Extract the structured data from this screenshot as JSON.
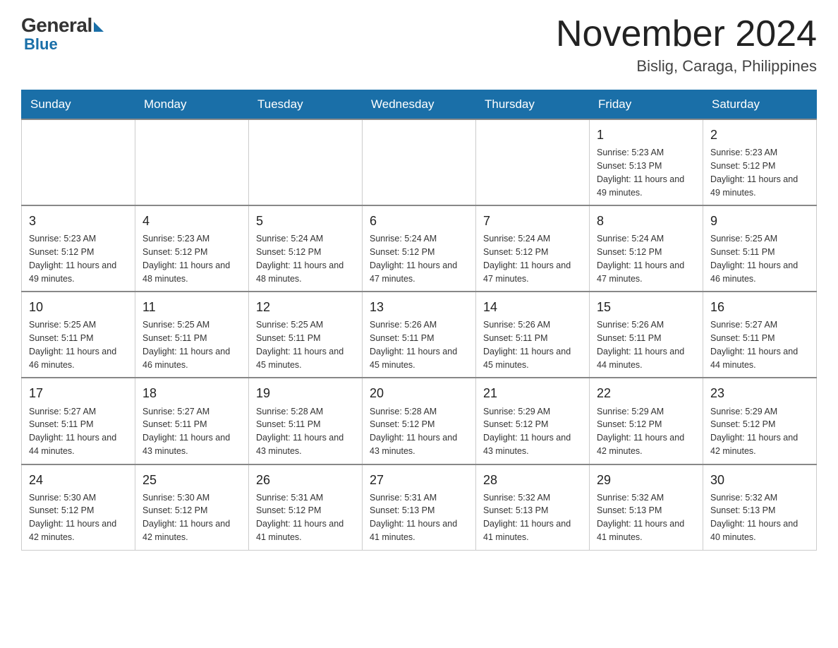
{
  "logo": {
    "general": "General",
    "blue": "Blue"
  },
  "title": {
    "month": "November 2024",
    "location": "Bislig, Caraga, Philippines"
  },
  "days_of_week": [
    "Sunday",
    "Monday",
    "Tuesday",
    "Wednesday",
    "Thursday",
    "Friday",
    "Saturday"
  ],
  "weeks": [
    [
      {
        "day": "",
        "info": ""
      },
      {
        "day": "",
        "info": ""
      },
      {
        "day": "",
        "info": ""
      },
      {
        "day": "",
        "info": ""
      },
      {
        "day": "",
        "info": ""
      },
      {
        "day": "1",
        "info": "Sunrise: 5:23 AM\nSunset: 5:13 PM\nDaylight: 11 hours and 49 minutes."
      },
      {
        "day": "2",
        "info": "Sunrise: 5:23 AM\nSunset: 5:12 PM\nDaylight: 11 hours and 49 minutes."
      }
    ],
    [
      {
        "day": "3",
        "info": "Sunrise: 5:23 AM\nSunset: 5:12 PM\nDaylight: 11 hours and 49 minutes."
      },
      {
        "day": "4",
        "info": "Sunrise: 5:23 AM\nSunset: 5:12 PM\nDaylight: 11 hours and 48 minutes."
      },
      {
        "day": "5",
        "info": "Sunrise: 5:24 AM\nSunset: 5:12 PM\nDaylight: 11 hours and 48 minutes."
      },
      {
        "day": "6",
        "info": "Sunrise: 5:24 AM\nSunset: 5:12 PM\nDaylight: 11 hours and 47 minutes."
      },
      {
        "day": "7",
        "info": "Sunrise: 5:24 AM\nSunset: 5:12 PM\nDaylight: 11 hours and 47 minutes."
      },
      {
        "day": "8",
        "info": "Sunrise: 5:24 AM\nSunset: 5:12 PM\nDaylight: 11 hours and 47 minutes."
      },
      {
        "day": "9",
        "info": "Sunrise: 5:25 AM\nSunset: 5:11 PM\nDaylight: 11 hours and 46 minutes."
      }
    ],
    [
      {
        "day": "10",
        "info": "Sunrise: 5:25 AM\nSunset: 5:11 PM\nDaylight: 11 hours and 46 minutes."
      },
      {
        "day": "11",
        "info": "Sunrise: 5:25 AM\nSunset: 5:11 PM\nDaylight: 11 hours and 46 minutes."
      },
      {
        "day": "12",
        "info": "Sunrise: 5:25 AM\nSunset: 5:11 PM\nDaylight: 11 hours and 45 minutes."
      },
      {
        "day": "13",
        "info": "Sunrise: 5:26 AM\nSunset: 5:11 PM\nDaylight: 11 hours and 45 minutes."
      },
      {
        "day": "14",
        "info": "Sunrise: 5:26 AM\nSunset: 5:11 PM\nDaylight: 11 hours and 45 minutes."
      },
      {
        "day": "15",
        "info": "Sunrise: 5:26 AM\nSunset: 5:11 PM\nDaylight: 11 hours and 44 minutes."
      },
      {
        "day": "16",
        "info": "Sunrise: 5:27 AM\nSunset: 5:11 PM\nDaylight: 11 hours and 44 minutes."
      }
    ],
    [
      {
        "day": "17",
        "info": "Sunrise: 5:27 AM\nSunset: 5:11 PM\nDaylight: 11 hours and 44 minutes."
      },
      {
        "day": "18",
        "info": "Sunrise: 5:27 AM\nSunset: 5:11 PM\nDaylight: 11 hours and 43 minutes."
      },
      {
        "day": "19",
        "info": "Sunrise: 5:28 AM\nSunset: 5:11 PM\nDaylight: 11 hours and 43 minutes."
      },
      {
        "day": "20",
        "info": "Sunrise: 5:28 AM\nSunset: 5:12 PM\nDaylight: 11 hours and 43 minutes."
      },
      {
        "day": "21",
        "info": "Sunrise: 5:29 AM\nSunset: 5:12 PM\nDaylight: 11 hours and 43 minutes."
      },
      {
        "day": "22",
        "info": "Sunrise: 5:29 AM\nSunset: 5:12 PM\nDaylight: 11 hours and 42 minutes."
      },
      {
        "day": "23",
        "info": "Sunrise: 5:29 AM\nSunset: 5:12 PM\nDaylight: 11 hours and 42 minutes."
      }
    ],
    [
      {
        "day": "24",
        "info": "Sunrise: 5:30 AM\nSunset: 5:12 PM\nDaylight: 11 hours and 42 minutes."
      },
      {
        "day": "25",
        "info": "Sunrise: 5:30 AM\nSunset: 5:12 PM\nDaylight: 11 hours and 42 minutes."
      },
      {
        "day": "26",
        "info": "Sunrise: 5:31 AM\nSunset: 5:12 PM\nDaylight: 11 hours and 41 minutes."
      },
      {
        "day": "27",
        "info": "Sunrise: 5:31 AM\nSunset: 5:13 PM\nDaylight: 11 hours and 41 minutes."
      },
      {
        "day": "28",
        "info": "Sunrise: 5:32 AM\nSunset: 5:13 PM\nDaylight: 11 hours and 41 minutes."
      },
      {
        "day": "29",
        "info": "Sunrise: 5:32 AM\nSunset: 5:13 PM\nDaylight: 11 hours and 41 minutes."
      },
      {
        "day": "30",
        "info": "Sunrise: 5:32 AM\nSunset: 5:13 PM\nDaylight: 11 hours and 40 minutes."
      }
    ]
  ]
}
